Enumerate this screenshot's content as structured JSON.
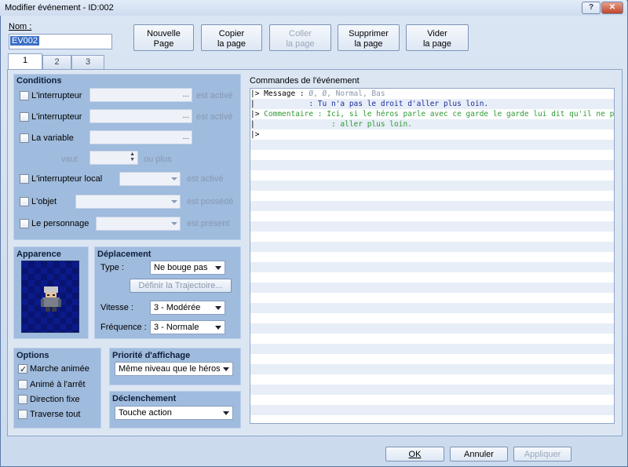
{
  "window": {
    "title": "Modifier événement - ID:002",
    "help": "?",
    "close": "✕"
  },
  "name": {
    "label": "Nom :",
    "value": "EV002"
  },
  "toolbar": {
    "new": "Nouvelle\nPage",
    "copy": "Copier\nla page",
    "paste": "Coller\nla page",
    "delete": "Supprimer\nla page",
    "clear": "Vider\nla page"
  },
  "tabs": [
    "1",
    "2",
    "3"
  ],
  "conditions": {
    "title": "Conditions",
    "switch1": "L'interrupteur",
    "switch1_state": "est activé",
    "switch2": "L'interrupteur",
    "switch2_state": "est activé",
    "variable": "La variable",
    "vaut": "vaut",
    "ou_plus": "ou plus",
    "local": "L'interrupteur local",
    "local_state": "est activé",
    "item": "L'objet",
    "item_state": "est possédé",
    "actor": "Le personnage",
    "actor_state": "est présent",
    "ellipsis": "..."
  },
  "appearance": {
    "title": "Apparence"
  },
  "movement": {
    "title": "Déplacement",
    "type_label": "Type :",
    "type_value": "Ne bouge pas",
    "route_button": "Définir la Trajectoire...",
    "speed_label": "Vitesse :",
    "speed_value": "3 - Modérée",
    "freq_label": "Fréquence :",
    "freq_value": "3 - Normale"
  },
  "options": {
    "title": "Options",
    "walk": "Marche animée",
    "walk_checked": "true",
    "stepping": "Animé à l'arrêt",
    "fixed": "Direction fixe",
    "through": "Traverse tout"
  },
  "priority": {
    "title": "Priorité d'affichage",
    "value": "Même niveau que le héros"
  },
  "trigger": {
    "title": "Déclenchement",
    "value": "Touche action"
  },
  "commands": {
    "title": "Commandes de l'événement",
    "rows": [
      {
        "a": "|> Message : ",
        "b": "Ø, Ø, Normal, Bas",
        "cls": "c-gray"
      },
      {
        "a": "|            ",
        "b": ": Tu n'a pas le droit d'aller plus loin.",
        "cls": "c-blue"
      },
      {
        "a": "|> ",
        "b": "Commentaire : Ici, si le héros parle avec ce garde le garde lui dit qu'il ne peut pas",
        "cls": "c-green"
      },
      {
        "a": "|                 ",
        "b": ": aller plus loin.",
        "cls": "c-green"
      },
      {
        "a": "|>",
        "b": "",
        "cls": ""
      }
    ]
  },
  "footer": {
    "ok": "OK",
    "cancel": "Annuler",
    "apply": "Appliquer"
  }
}
